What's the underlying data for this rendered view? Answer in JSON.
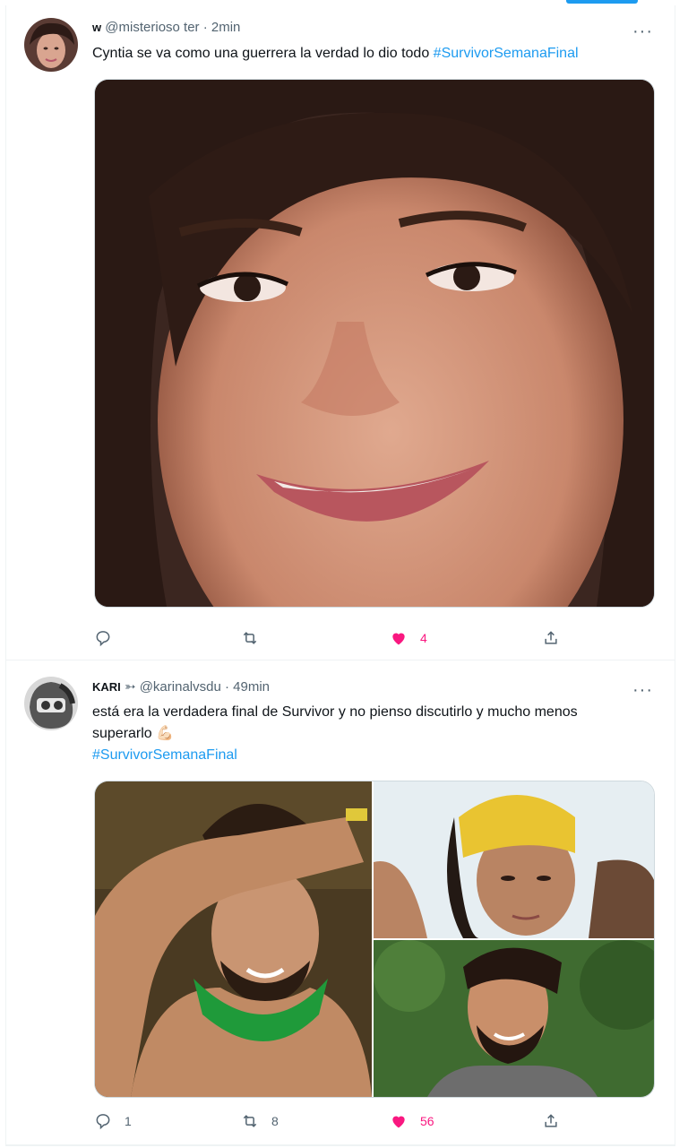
{
  "tweets": [
    {
      "name": "w",
      "handle": "@misterioso ter",
      "sep": "·",
      "time": "2min",
      "text": "Cyntia se va como una guerrera la verdad lo dio todo ",
      "hashtag": "#SurvivorSemanaFinal",
      "actions": {
        "reply": "",
        "retweet": "",
        "like": "4"
      }
    },
    {
      "name": "KARI",
      "name_icon": "➳",
      "handle": "@karinalvsdu",
      "sep": "·",
      "time": "49min",
      "text": "está era la verdadera final de Survivor y no pienso discutirlo y mucho menos superarlo 💪🏻",
      "hashtag": "#SurvivorSemanaFinal",
      "actions": {
        "reply": "1",
        "retweet": "8",
        "like": "56"
      }
    }
  ],
  "more_label": "···",
  "colors": {
    "accent": "#1d9bf0",
    "like": "#f91880",
    "muted": "#536471"
  },
  "icons": [
    "reply-icon",
    "retweet-icon",
    "heart-icon",
    "share-icon",
    "more-icon"
  ]
}
